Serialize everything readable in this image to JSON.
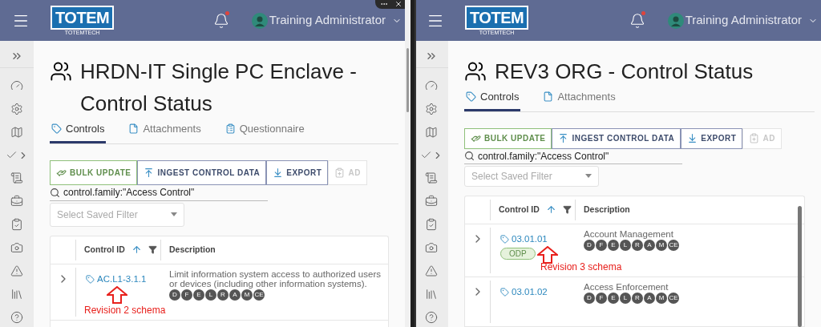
{
  "panels": [
    {
      "window_controls": true,
      "header": {
        "logo": "TOTEM",
        "logo_sub": "TOTEMTECH",
        "user": "Training Administrator",
        "notification": true
      },
      "title": "HRDN-IT Single PC Enclave - Control Status",
      "tabs": [
        {
          "label": "Controls",
          "selected": true
        },
        {
          "label": "Attachments",
          "selected": false
        },
        {
          "label": "Questionnaire",
          "selected": false
        }
      ],
      "actions": [
        {
          "label": "BULK UPDATE",
          "kind": "bulk",
          "disabled": false
        },
        {
          "label": "INGEST CONTROL DATA",
          "kind": "ingest",
          "disabled": false
        },
        {
          "label": "EXPORT",
          "kind": "export",
          "disabled": false
        },
        {
          "label": "AD",
          "kind": "add",
          "disabled": true
        }
      ],
      "search": {
        "value": "control.family:\"Access Control\""
      },
      "saved_filter": {
        "placeholder": "Select Saved Filter"
      },
      "table": {
        "columns": [
          "Control ID",
          "Description"
        ],
        "scrollbar": false,
        "rows": [
          {
            "expanded": false,
            "id": "AC.L1-3.1.1",
            "description": "Limit information system access to authorized users or devices (including other information systems).",
            "badges": [
              "D",
              "F",
              "E",
              "L",
              "R",
              "A",
              "M",
              "CE"
            ],
            "annotation": "Revision 2 schema"
          }
        ]
      }
    },
    {
      "window_controls": false,
      "header": {
        "logo": "TOTEM",
        "logo_sub": "TOTEMTECH",
        "user": "Training Administrator",
        "notification": true
      },
      "title": "REV3 ORG - Control Status",
      "tabs": [
        {
          "label": "Controls",
          "selected": true
        },
        {
          "label": "Attachments",
          "selected": false
        }
      ],
      "actions": [
        {
          "label": "BULK UPDATE",
          "kind": "bulk",
          "disabled": false
        },
        {
          "label": "INGEST CONTROL DATA",
          "kind": "ingest",
          "disabled": false
        },
        {
          "label": "EXPORT",
          "kind": "export",
          "disabled": false
        },
        {
          "label": "AD",
          "kind": "add",
          "disabled": true
        }
      ],
      "search": {
        "value": "control.family:\"Access Control\""
      },
      "saved_filter": {
        "placeholder": "Select Saved Filter"
      },
      "table": {
        "columns": [
          "Control ID",
          "Description"
        ],
        "scrollbar": true,
        "rows": [
          {
            "expanded": false,
            "id": "03.01.01",
            "tag": "ODP",
            "description": "Account Management",
            "badges": [
              "D",
              "F",
              "E",
              "L",
              "R",
              "A",
              "M",
              "CE"
            ],
            "annotation": "Revision 3 schema"
          },
          {
            "expanded": false,
            "id": "03.01.02",
            "description": "Access Enforcement",
            "badges": [
              "D",
              "F",
              "E",
              "L",
              "R",
              "A",
              "M",
              "CE"
            ]
          }
        ]
      }
    }
  ]
}
